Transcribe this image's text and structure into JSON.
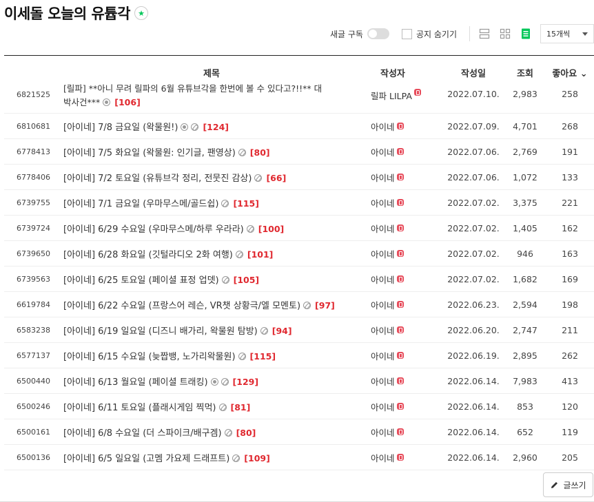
{
  "header": {
    "title": "이세돌 오늘의 유튭각",
    "star": "★"
  },
  "toolbar": {
    "subscribe_label": "새글 구독",
    "notice_label": "공지 숨기기",
    "per_page": "15개씩"
  },
  "columns": {
    "title": "제목",
    "writer": "작성자",
    "date": "작성일",
    "views": "조회",
    "likes": "좋아요 ⌄"
  },
  "rows": [
    {
      "id": "6821525",
      "title_line1": "[릴파] **아니 무려 릴파의 6월 유튜브각을 한번에 볼 수 있다고?!!** 대",
      "title_line2": "박사건***",
      "icons": [
        "img"
      ],
      "comments": "[106]",
      "writer": "릴파 LILPA",
      "date": "2022.07.10.",
      "views": "2,983",
      "likes": "258"
    },
    {
      "id": "6810681",
      "title": "[아이네] 7/8 금요일 (왁물원!)",
      "icons": [
        "img",
        "link"
      ],
      "comments": "[124]",
      "writer": "아이네",
      "date": "2022.07.09.",
      "views": "4,701",
      "likes": "268"
    },
    {
      "id": "6778413",
      "title": "[아이네] 7/5 화요일 (왁물원: 인기글, 팬영상)",
      "icons": [
        "link"
      ],
      "comments": "[80]",
      "writer": "아이네",
      "date": "2022.07.06.",
      "views": "2,769",
      "likes": "191"
    },
    {
      "id": "6778406",
      "title": "[아이네] 7/2 토요일 (유튜브각 정리, 전뭇진 감상)",
      "icons": [
        "link"
      ],
      "comments": "[66]",
      "writer": "아이네",
      "date": "2022.07.06.",
      "views": "1,072",
      "likes": "133"
    },
    {
      "id": "6739755",
      "title": "[아이네] 7/1 금요일 (우마무스메/골드쉽)",
      "icons": [
        "link"
      ],
      "comments": "[115]",
      "writer": "아이네",
      "date": "2022.07.02.",
      "views": "3,375",
      "likes": "221"
    },
    {
      "id": "6739724",
      "title": "[아이네] 6/29 수요일 (우마무스메/하루 우라라)",
      "icons": [
        "link"
      ],
      "comments": "[100]",
      "writer": "아이네",
      "date": "2022.07.02.",
      "views": "1,405",
      "likes": "162"
    },
    {
      "id": "6739650",
      "title": "[아이네] 6/28 화요일 (깃털라디오 2화 여행)",
      "icons": [
        "link"
      ],
      "comments": "[101]",
      "writer": "아이네",
      "date": "2022.07.02.",
      "views": "946",
      "likes": "163"
    },
    {
      "id": "6739563",
      "title": "[아이네] 6/25 토요일 (페이셜 표정 업뎃)",
      "icons": [
        "link"
      ],
      "comments": "[105]",
      "writer": "아이네",
      "date": "2022.07.02.",
      "views": "1,682",
      "likes": "169"
    },
    {
      "id": "6619784",
      "title": "[아이네] 6/22 수요일 (프랑스어 레슨, VR챗 상황극/엘 모멘토)",
      "icons": [
        "link"
      ],
      "comments": "[97]",
      "writer": "아이네",
      "date": "2022.06.23.",
      "views": "2,594",
      "likes": "198"
    },
    {
      "id": "6583238",
      "title": "[아이네] 6/19 일요일 (디즈니 배가리, 왁물원 탐방)",
      "icons": [
        "link"
      ],
      "comments": "[94]",
      "writer": "아이네",
      "date": "2022.06.20.",
      "views": "2,747",
      "likes": "211"
    },
    {
      "id": "6577137",
      "title": "[아이네] 6/15 수요일 (늦짭뱅, 노가리왁물원)",
      "icons": [
        "link"
      ],
      "comments": "[115]",
      "writer": "아이네",
      "date": "2022.06.19.",
      "views": "2,895",
      "likes": "262"
    },
    {
      "id": "6500440",
      "title": "[아이네] 6/13 월요일 (페이셜 트래킹)",
      "icons": [
        "img",
        "link"
      ],
      "comments": "[129]",
      "writer": "아이네",
      "date": "2022.06.14.",
      "views": "7,983",
      "likes": "413"
    },
    {
      "id": "6500246",
      "title": "[아이네] 6/11 토요일 (플래시게임 찍먹)",
      "icons": [
        "link"
      ],
      "comments": "[81]",
      "writer": "아이네",
      "date": "2022.06.14.",
      "views": "853",
      "likes": "120"
    },
    {
      "id": "6500161",
      "title": "[아이네] 6/8 수요일 (더 스파이크/배구겜)",
      "icons": [
        "link"
      ],
      "comments": "[80]",
      "writer": "아이네",
      "date": "2022.06.14.",
      "views": "652",
      "likes": "119"
    },
    {
      "id": "6500136",
      "title": "[아이네] 6/5 일요일 (고멤 가요제 드래프트)",
      "icons": [
        "link"
      ],
      "comments": "[109]",
      "writer": "아이네",
      "date": "2022.06.14.",
      "views": "2,960",
      "likes": "205"
    }
  ],
  "write_button": "글쓰기",
  "colors": {
    "accent": "#03c75a",
    "comment": "#e0282f",
    "badge": "#e74c5b"
  }
}
